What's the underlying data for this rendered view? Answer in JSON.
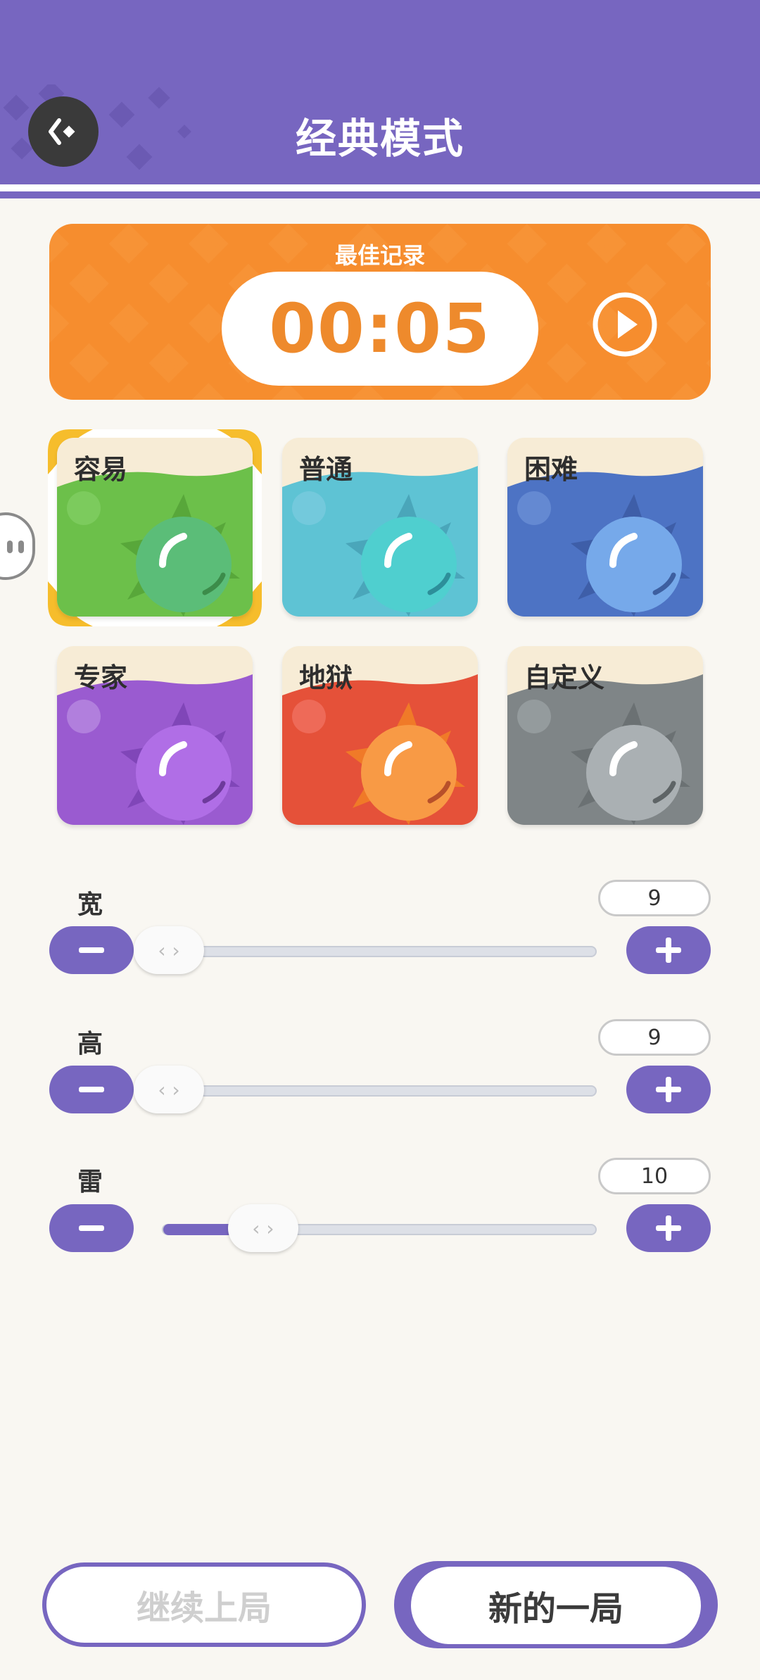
{
  "header": {
    "title": "经典模式",
    "back_icon": "back-arrow-icon"
  },
  "record": {
    "label": "最佳记录",
    "time": "00:05",
    "play_icon": "play-icon"
  },
  "difficulties": [
    {
      "label": "容易",
      "selected": true
    },
    {
      "label": "普通",
      "selected": false
    },
    {
      "label": "困难",
      "selected": false
    },
    {
      "label": "专家",
      "selected": false
    },
    {
      "label": "地狱",
      "selected": false
    },
    {
      "label": "自定义",
      "selected": false
    }
  ],
  "sliders": {
    "width": {
      "label": "宽",
      "value": "9",
      "fraction": 0.0
    },
    "height": {
      "label": "高",
      "value": "9",
      "fraction": 0.0
    },
    "mines": {
      "label": "雷",
      "value": "10",
      "fraction": 0.24
    }
  },
  "buttons": {
    "continue_label": "继续上局",
    "new_label": "新的一局"
  },
  "colors": {
    "primary": "#7766c0",
    "accent_orange": "#f68d2e",
    "tile_easy": "#6cc04a",
    "tile_normal": "#5ec3d4",
    "tile_hard": "#4d73c4",
    "tile_expert": "#9a5bd0",
    "tile_hell": "#e55139",
    "tile_custom": "#7f8587"
  }
}
